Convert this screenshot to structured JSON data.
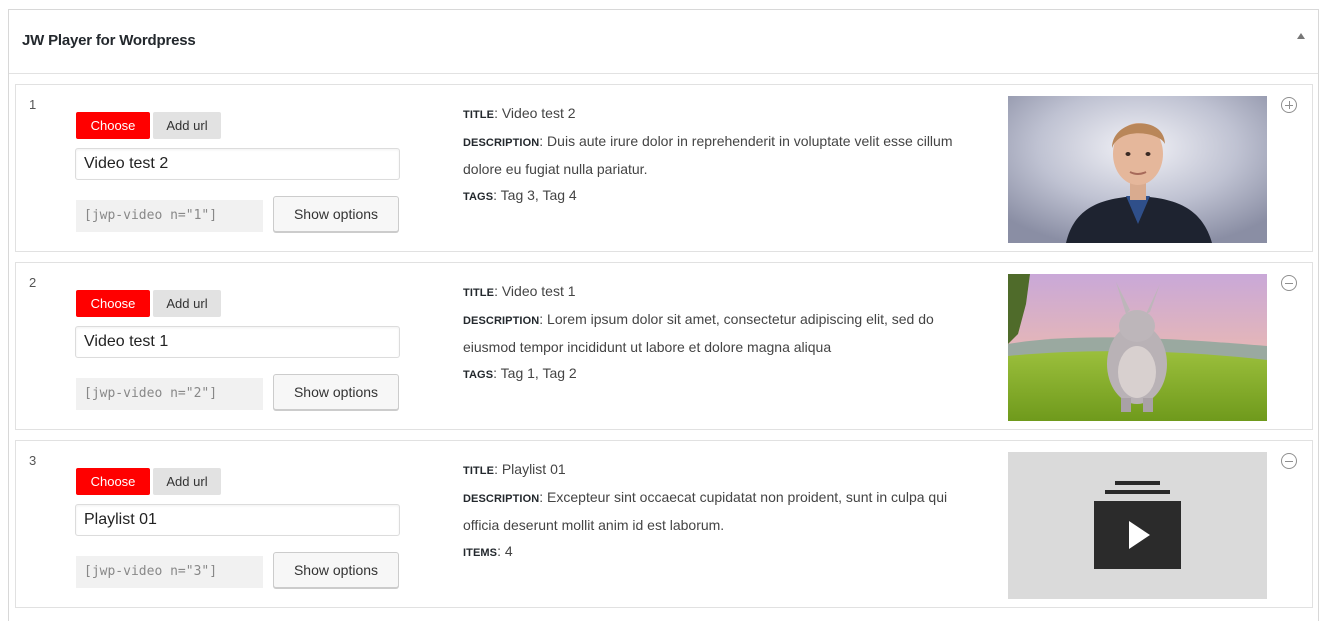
{
  "panel": {
    "title": "JW Player for Wordpress"
  },
  "items": [
    {
      "number": "1",
      "choose_label": "Choose",
      "addurl_label": "Add url",
      "title_value": "Video test 2",
      "shortcode": "[jwp-video n=\"1\"]",
      "options_label": "Show options",
      "meta": [
        {
          "label": "TITLE",
          "value": ": Video test 2"
        },
        {
          "label": "DESCRIPTION",
          "value": ": Duis aute irure dolor in reprehenderit in voluptate velit esse cillum dolore eu fugiat nulla pariatur."
        },
        {
          "label": "TAGS",
          "value": ": Tag 3, Tag 4"
        }
      ],
      "thumbnail": "presenter-video-thumbnail",
      "toggle": "plus-circle-icon"
    },
    {
      "number": "2",
      "choose_label": "Choose",
      "addurl_label": "Add url",
      "title_value": "Video test 1",
      "shortcode": "[jwp-video n=\"2\"]",
      "options_label": "Show options",
      "meta": [
        {
          "label": "TITLE",
          "value": ": Video test 1"
        },
        {
          "label": "DESCRIPTION",
          "value": ": Lorem ipsum dolor sit amet, consectetur adipiscing elit, sed do eiusmod tempor incididunt ut labore et dolore magna aliqua"
        },
        {
          "label": "TAGS",
          "value": ": Tag 1, Tag 2"
        }
      ],
      "thumbnail": "animated-rabbit-thumbnail",
      "toggle": "minus-circle-icon"
    },
    {
      "number": "3",
      "choose_label": "Choose",
      "addurl_label": "Add url",
      "title_value": "Playlist 01",
      "shortcode": "[jwp-video n=\"3\"]",
      "options_label": "Show options",
      "meta": [
        {
          "label": "TITLE",
          "value": ": Playlist 01"
        },
        {
          "label": "DESCRIPTION",
          "value": ": Excepteur sint occaecat cupidatat non proident, sunt in culpa qui officia deserunt mollit anim id est laborum."
        },
        {
          "label": "ITEMS",
          "value": ": 4"
        }
      ],
      "thumbnail": "playlist-icon",
      "toggle": "minus-circle-icon"
    }
  ],
  "colors": {
    "choose": "#ff0000",
    "addurl": "#e2e2e2",
    "playlist_bg": "#dadada",
    "playlist_icon": "#2b2b2b"
  }
}
